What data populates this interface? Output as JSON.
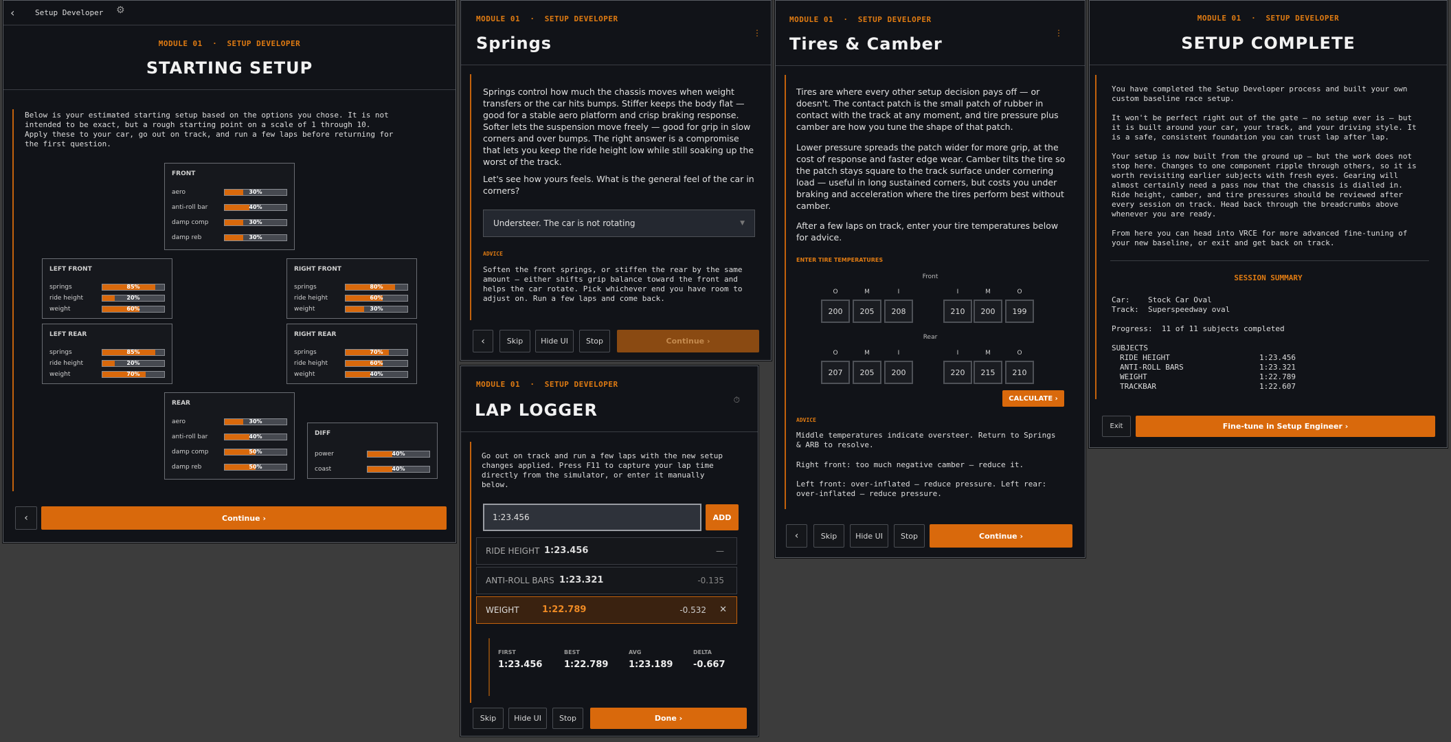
{
  "topbar": {
    "title": "Setup Developer"
  },
  "module_label": "MODULE 01",
  "dot": "·",
  "module_sub": "SETUP DEVELOPER",
  "p1": {
    "title": "STARTING SETUP",
    "intro": "Below is your estimated starting setup based on the options you chose. It is not\nintended to be exact, but a rough starting point on a scale of 1 through 10.\nApply these to your car, go out on track, and run a few laps before returning for\nthe first question.",
    "front": {
      "title": "FRONT",
      "rows": [
        {
          "label": "aero",
          "value": "30%",
          "pct": 0.3
        },
        {
          "label": "anti-roll bar",
          "value": "40%",
          "pct": 0.4
        },
        {
          "label": "damp comp",
          "value": "30%",
          "pct": 0.3
        },
        {
          "label": "damp reb",
          "value": "30%",
          "pct": 0.3
        }
      ]
    },
    "lf": {
      "title": "LEFT FRONT",
      "rows": [
        {
          "label": "springs",
          "value": "85%",
          "pct": 0.85
        },
        {
          "label": "ride height",
          "value": "20%",
          "pct": 0.2
        },
        {
          "label": "weight",
          "value": "60%",
          "pct": 0.6
        }
      ]
    },
    "rf": {
      "title": "RIGHT FRONT",
      "rows": [
        {
          "label": "springs",
          "value": "80%",
          "pct": 0.8
        },
        {
          "label": "ride height",
          "value": "60%",
          "pct": 0.6
        },
        {
          "label": "weight",
          "value": "30%",
          "pct": 0.3
        }
      ]
    },
    "lr": {
      "title": "LEFT REAR",
      "rows": [
        {
          "label": "springs",
          "value": "85%",
          "pct": 0.85
        },
        {
          "label": "ride height",
          "value": "20%",
          "pct": 0.2
        },
        {
          "label": "weight",
          "value": "70%",
          "pct": 0.7
        }
      ]
    },
    "rr": {
      "title": "RIGHT REAR",
      "rows": [
        {
          "label": "springs",
          "value": "70%",
          "pct": 0.7
        },
        {
          "label": "ride height",
          "value": "60%",
          "pct": 0.6
        },
        {
          "label": "weight",
          "value": "40%",
          "pct": 0.4
        }
      ]
    },
    "rear": {
      "title": "REAR",
      "rows": [
        {
          "label": "aero",
          "value": "30%",
          "pct": 0.3
        },
        {
          "label": "anti-roll bar",
          "value": "40%",
          "pct": 0.4
        },
        {
          "label": "damp comp",
          "value": "50%",
          "pct": 0.5
        },
        {
          "label": "damp reb",
          "value": "50%",
          "pct": 0.5
        }
      ]
    },
    "diff": {
      "title": "DIFF",
      "rows": [
        {
          "label": "power",
          "value": "40%",
          "pct": 0.4
        },
        {
          "label": "coast",
          "value": "40%",
          "pct": 0.4
        }
      ]
    },
    "back": "‹",
    "continue": "Continue ›"
  },
  "p2": {
    "title": "Springs",
    "menu": "⋮",
    "body1": "Springs control how much the chassis moves when weight transfers or the car hits bumps. Stiffer keeps the body flat — good for a stable aero platform and crisp braking response. Softer lets the suspension move freely — good for grip in slow corners and over bumps. The right answer is a compromise that lets you keep the ride height low while still soaking up the worst of the track.",
    "body2": "Let's see how yours feels. What is the general feel of the car in corners?",
    "select": "Understeer. The car is not rotating",
    "advice_label": "ADVICE",
    "advice": "Soften the front springs, or stiffen the rear by the same amount — either shifts grip balance toward the front and helps the car rotate. Pick whichever end you have room to adjust on. Run a few laps and come back.",
    "back": "‹",
    "skip": "Skip",
    "hide": "Hide UI",
    "stop": "Stop",
    "continue": "Continue ›"
  },
  "p3": {
    "title": "Tires & Camber",
    "menu": "⋮",
    "body1": "Tires are where every other setup decision pays off — or doesn't. The contact patch is the small patch of rubber in contact with the track at any moment, and tire pressure plus camber are how you tune the shape of that patch.",
    "body2": "Lower pressure spreads the patch wider for more grip, at the cost of response and faster edge wear. Camber tilts the tire so the patch stays square to the track surface under cornering load — useful in long sustained corners, but costs you under braking and acceleration where the tires perform best without camber.",
    "body3": "After a few laps on track, enter your tire temperatures below for advice.",
    "enter_label": "ENTER TIRE TEMPERATURES",
    "front_label": "Front",
    "rear_label": "Rear",
    "cols_left": [
      "O",
      "M",
      "I"
    ],
    "cols_right": [
      "I",
      "M",
      "O"
    ],
    "front_left": [
      "200",
      "205",
      "208"
    ],
    "front_right": [
      "210",
      "200",
      "199"
    ],
    "rear_left": [
      "207",
      "205",
      "200"
    ],
    "rear_right": [
      "220",
      "215",
      "210"
    ],
    "calculate": "CALCULATE ›",
    "advice_label": "ADVICE",
    "advice1": "Middle temperatures indicate oversteer. Return to Springs\n& ARB to resolve.",
    "advice2": "Right front: too much negative camber — reduce it.",
    "advice3": "Left front: over-inflated — reduce pressure. Left rear:\nover-inflated — reduce pressure.",
    "back": "‹",
    "skip": "Skip",
    "hide": "Hide UI",
    "stop": "Stop",
    "continue": "Continue ›"
  },
  "p4": {
    "title": "SETUP COMPLETE",
    "t1": "You have completed the Setup Developer process and built your own\ncustom baseline race setup.",
    "t2": "It won't be perfect right out of the gate — no setup ever is — but\nit is built around your car, your track, and your driving style. It\nis a safe, consistent foundation you can trust lap after lap.",
    "t3": "Your setup is now built from the ground up — but the work does not\nstop here. Changes to one component ripple through others, so it is\nworth revisiting earlier subjects with fresh eyes. Gearing will\nalmost certainly need a pass now that the chassis is dialled in.\nRide height, camber, and tire pressures should be reviewed after\nevery session on track. Head back through the breadcrumbs above\nwhenever you are ready.",
    "t4": "From here you can head into VRCE for more advanced fine-tuning of\nyour new baseline, or exit and get back on track.",
    "summary_title": "SESSION SUMMARY",
    "car": "Car:    Stock Car Oval",
    "track": "Track:  Superspeedway oval",
    "progress": "Progress:  11 of 11 subjects completed",
    "subjects": "SUBJECTS",
    "subject_rows": [
      [
        "RIDE HEIGHT",
        "1:23.456"
      ],
      [
        "ANTI-ROLL BARS",
        "1:23.321"
      ],
      [
        "WEIGHT",
        "1:22.789"
      ],
      [
        "TRACKBAR",
        "1:22.607"
      ]
    ],
    "exit": "Exit",
    "finetune": "Fine-tune in Setup Engineer ›"
  },
  "p5": {
    "title": "LAP LOGGER",
    "body": "Go out on track and run a few laps with the new setup\nchanges applied. Press F11 to capture your lap time\ndirectly from the simulator, or enter it manually\nbelow.",
    "input": "1:23.456",
    "add": "ADD",
    "logs": [
      {
        "name": "RIDE HEIGHT",
        "time": "1:23.456",
        "delta": "—"
      },
      {
        "name": "ANTI-ROLL BARS",
        "time": "1:23.321",
        "delta": "-0.135"
      },
      {
        "name": "WEIGHT",
        "time": "1:22.789",
        "delta": "-0.532",
        "close": "✕"
      }
    ],
    "stats": [
      {
        "label": "FIRST",
        "value": "1:23.456"
      },
      {
        "label": "BEST",
        "value": "1:22.789"
      },
      {
        "label": "AVG",
        "value": "1:23.189"
      },
      {
        "label": "DELTA",
        "value": "-0.667"
      }
    ],
    "skip": "Skip",
    "hide": "Hide UI",
    "stop": "Stop",
    "done": "Done ›"
  }
}
